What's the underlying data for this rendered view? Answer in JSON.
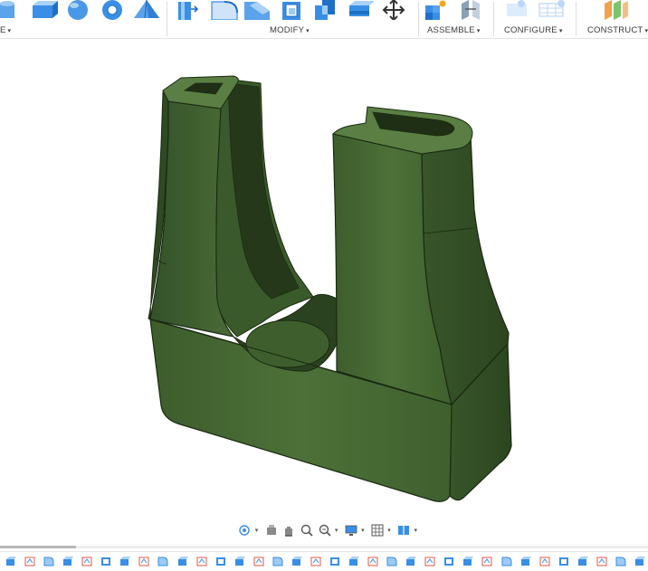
{
  "toolbar": {
    "create_label_partial": "E",
    "modify_label": "MODIFY",
    "assemble_label": "ASSEMBLE",
    "configure_label": "CONFIGURE",
    "construct_label": "CONSTRUCT",
    "caret": "▾"
  },
  "navbar": {
    "tools": [
      "orbit-icon",
      "look-at-icon",
      "pan-icon",
      "zoom-icon",
      "fit-icon",
      "display-settings-icon",
      "grid-settings-icon",
      "viewports-icon"
    ]
  },
  "timeline": {
    "feature_count": 34
  },
  "colors": {
    "model_green": "#4a6b35",
    "model_dark": "#2f4a22",
    "model_light": "#5e8246",
    "accent_blue": "#3a8ee6"
  }
}
